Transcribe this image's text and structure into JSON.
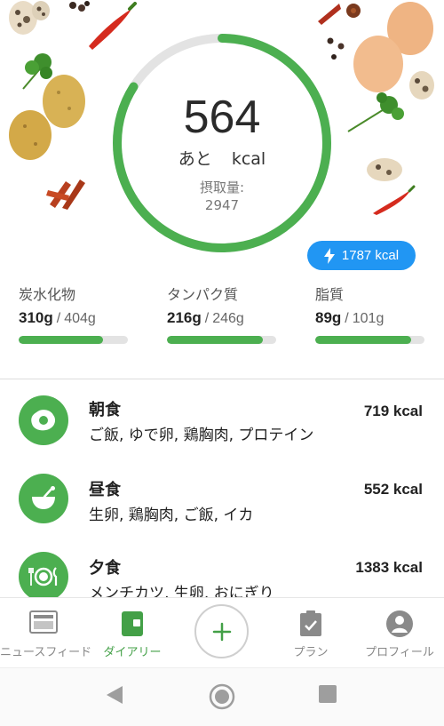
{
  "summary": {
    "remaining_value": "564",
    "remaining_prefix": "あと",
    "remaining_unit": "kcal",
    "consumed_label": "摂取量:",
    "consumed_value": "2947",
    "burned_label": "1787 kcal",
    "ring_progress": 0.84
  },
  "macros": [
    {
      "name": "炭水化物",
      "amount": "310g",
      "target": "404g",
      "progress": 0.77
    },
    {
      "name": "タンパク質",
      "amount": "216g",
      "target": "246g",
      "progress": 0.88
    },
    {
      "name": "脂質",
      "amount": "89g",
      "target": "101g",
      "progress": 0.88
    }
  ],
  "meals": [
    {
      "name": "朝食",
      "items": "ご飯, ゆで卵, 鶏胸肉, プロテイン",
      "kcal": "719 kcal",
      "icon": "egg-icon"
    },
    {
      "name": "昼食",
      "items": "生卵, 鶏胸肉, ご飯, イカ",
      "kcal": "552 kcal",
      "icon": "bowl-icon"
    },
    {
      "name": "夕食",
      "items": "メンチカツ, 生卵, おにぎり",
      "kcal": "1383 kcal",
      "icon": "plate-icon"
    }
  ],
  "nav": {
    "newsfeed": "ニュースフィード",
    "diary": "ダイアリー",
    "plan": "プラン",
    "profile": "プロフィール"
  },
  "colors": {
    "accent": "#4caf50",
    "active_nav": "#43a047",
    "badge": "#2196f3",
    "track": "#e3e3e3"
  }
}
